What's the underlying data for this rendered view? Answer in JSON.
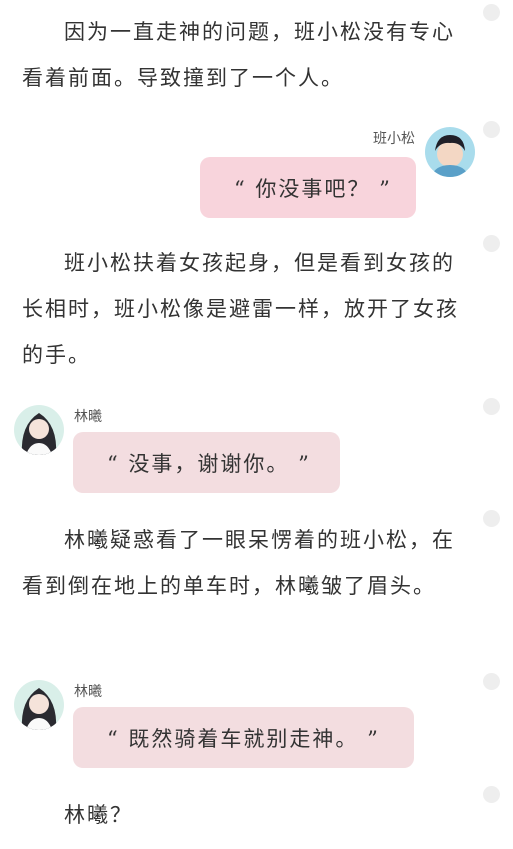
{
  "paragraphs": [
    "因为一直走神的问题，班小松没有专心看着前面。导致撞到了一个人。",
    "班小松扶着女孩起身，但是看到女孩的长相时，班小松像是避雷一样，放开了女孩的手。",
    "林曦疑惑看了一眼呆愣着的班小松，在看到倒在地上的单车时，林曦皱了眉头。",
    "林曦？"
  ],
  "messages": [
    {
      "speaker": "班小松",
      "text": "“ 你没事吧？ ”",
      "side": "right",
      "avatar": "boy-avatar"
    },
    {
      "speaker": "林曦",
      "text": "“ 没事，谢谢你。 ”",
      "side": "left",
      "avatar": "girl-avatar"
    },
    {
      "speaker": "林曦",
      "text": "“ 既然骑着车就别走神。 ”",
      "side": "left",
      "avatar": "girl-avatar"
    }
  ],
  "colors": {
    "right_bubble": "#f8d4dc",
    "left_bubble": "#f3dde0",
    "text": "#333333",
    "margin_dot": "#eeeeee"
  }
}
